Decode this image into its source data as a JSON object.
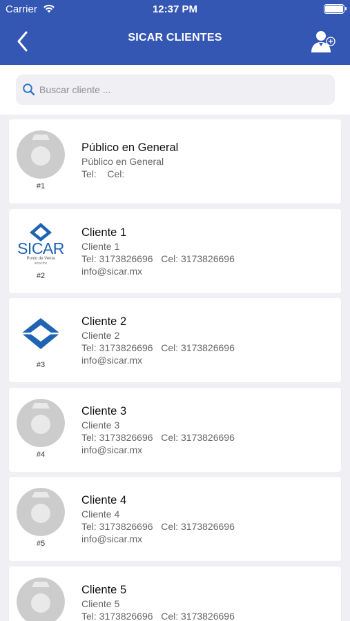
{
  "status_bar": {
    "carrier": "Carrier",
    "time": "12:37 PM"
  },
  "header": {
    "title": "SICAR CLIENTES",
    "back_icon": "chevron-left-icon",
    "add_icon": "add-user-icon"
  },
  "search": {
    "placeholder": "Buscar cliente ...",
    "value": ""
  },
  "clients": [
    {
      "id": "#1",
      "name": "Público en General",
      "subtitle": "Público en General",
      "contact": "Tel:    Cel:",
      "email": "",
      "avatar": "camera-placeholder"
    },
    {
      "id": "#2",
      "name": "Cliente 1",
      "subtitle": "Cliente 1",
      "contact": "Tel: 3173826696   Cel: 3173826696",
      "email": "info@sicar.mx",
      "avatar": "sicar-logo"
    },
    {
      "id": "#3",
      "name": "Cliente 2",
      "subtitle": "Cliente 2",
      "contact": "Tel: 3173826696   Cel: 3173826696",
      "email": "info@sicar.mx",
      "avatar": "sicar-diamond"
    },
    {
      "id": "#4",
      "name": "Cliente 3",
      "subtitle": "Cliente 3",
      "contact": "Tel: 3173826696   Cel: 3173826696",
      "email": "info@sicar.mx",
      "avatar": "camera-placeholder"
    },
    {
      "id": "#5",
      "name": "Cliente 4",
      "subtitle": "Cliente 4",
      "contact": "Tel: 3173826696   Cel: 3173826696",
      "email": "info@sicar.mx",
      "avatar": "camera-placeholder"
    },
    {
      "id": "",
      "name": "Cliente 5",
      "subtitle": "Cliente 5",
      "contact": "Tel: 3173826696   Cel: 3173826696",
      "email": "",
      "avatar": "camera-placeholder"
    }
  ],
  "logo_text": {
    "brand": "SICAR",
    "tagline": "Punto de Venta",
    "small": "sicar.mx"
  },
  "colors": {
    "header": "#3557b4",
    "background": "#efeff4",
    "logo_blue": "#1f63b5"
  }
}
